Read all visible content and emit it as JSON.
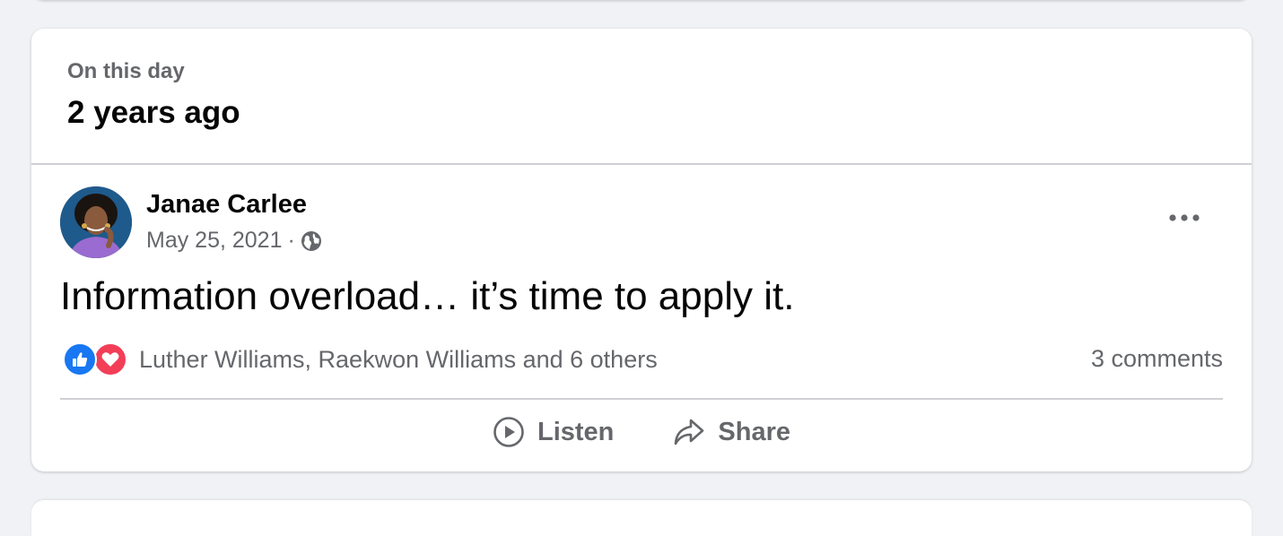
{
  "memory": {
    "label": "On this day",
    "title": "2 years ago"
  },
  "post": {
    "author": "Janae Carlee",
    "date": "May 25, 2021",
    "separator": "·",
    "privacy_icon": "globe-icon",
    "text": "Information overload… it’s time to apply it.",
    "reactions": {
      "icons": [
        "like-icon",
        "love-icon"
      ],
      "names": "Luther Williams, Raekwon Williams and 6 others"
    },
    "comments": "3 comments"
  },
  "actions": {
    "listen_label": "Listen",
    "share_label": "Share"
  },
  "colors": {
    "background": "#f0f2f5",
    "card": "#ffffff",
    "secondary_text": "#65676b",
    "like_blue": "#1877f2",
    "love_red": "#f33e58"
  }
}
